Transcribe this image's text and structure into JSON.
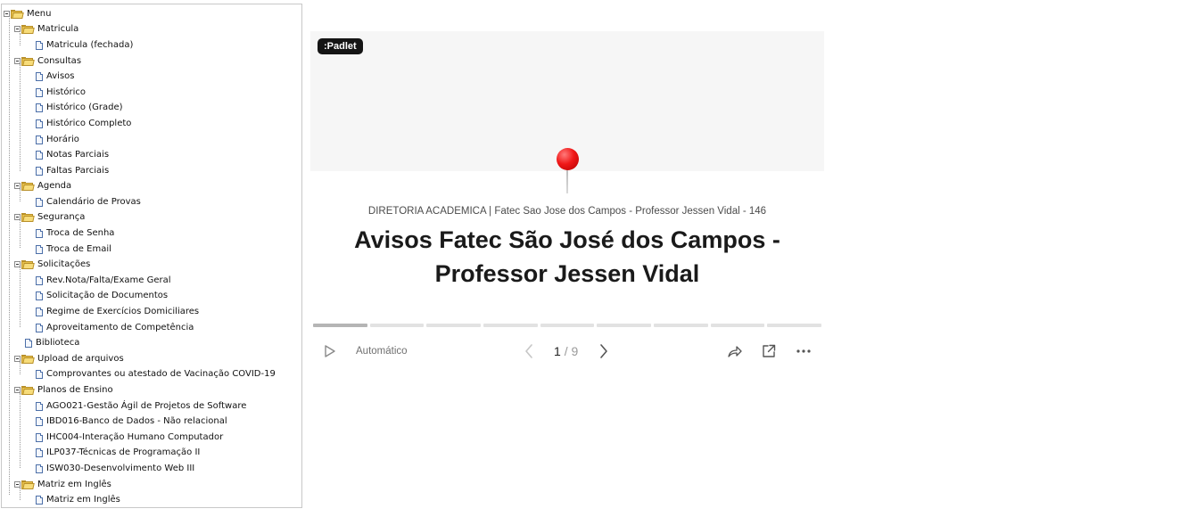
{
  "menu": {
    "root": "Menu",
    "matricula": {
      "label": "Matricula",
      "items": [
        "Matricula (fechada)"
      ]
    },
    "consultas": {
      "label": "Consultas",
      "items": [
        "Avisos",
        "Histórico",
        "Histórico (Grade)",
        "Histórico Completo",
        "Horário",
        "Notas Parciais",
        "Faltas Parciais"
      ]
    },
    "agenda": {
      "label": "Agenda",
      "items": [
        "Calendário de Provas"
      ]
    },
    "seguranca": {
      "label": "Segurança",
      "items": [
        "Troca de Senha",
        "Troca de Email"
      ]
    },
    "solicitacoes": {
      "label": "Solicitações",
      "items": [
        "Rev.Nota/Falta/Exame Geral",
        "Solicitação de Documentos",
        "Regime de Exercícios Domiciliares",
        "Aproveitamento de Competência"
      ]
    },
    "biblioteca": "Biblioteca",
    "upload": {
      "label": "Upload de arquivos",
      "items": [
        "Comprovantes ou atestado de Vacinação COVID-19"
      ]
    },
    "planos": {
      "label": "Planos de Ensino",
      "items": [
        "AGO021-Gestão Ágil de Projetos de Software",
        "IBD016-Banco de Dados - Não relacional",
        "IHC004-Interação Humano Computador",
        "ILP037-Técnicas de Programação II",
        "ISW030-Desenvolvimento Web III"
      ]
    },
    "matriz": {
      "label": "Matriz em Inglês",
      "items": [
        "Matriz em Inglês"
      ]
    }
  },
  "padlet": {
    "badge": ":Padlet",
    "subtitle": "DIRETORIA ACADEMICA | Fatec Sao Jose dos Campos - Professor Jessen Vidal - 146",
    "title": "Avisos Fatec São José dos Campos - Professor Jessen Vidal",
    "autoplay_label": "Automático",
    "pager": {
      "current": "1",
      "separator": "/",
      "total": "9"
    },
    "progress_segments": 9,
    "progress_active_index": 0,
    "icons": [
      "play-icon",
      "chevron-left-icon",
      "chevron-right-icon",
      "share-icon",
      "open-external-icon",
      "more-icon"
    ],
    "colors": {
      "badge_bg": "#151515",
      "pin": "#f01818",
      "cover_bg": "#f6f6f6"
    }
  }
}
